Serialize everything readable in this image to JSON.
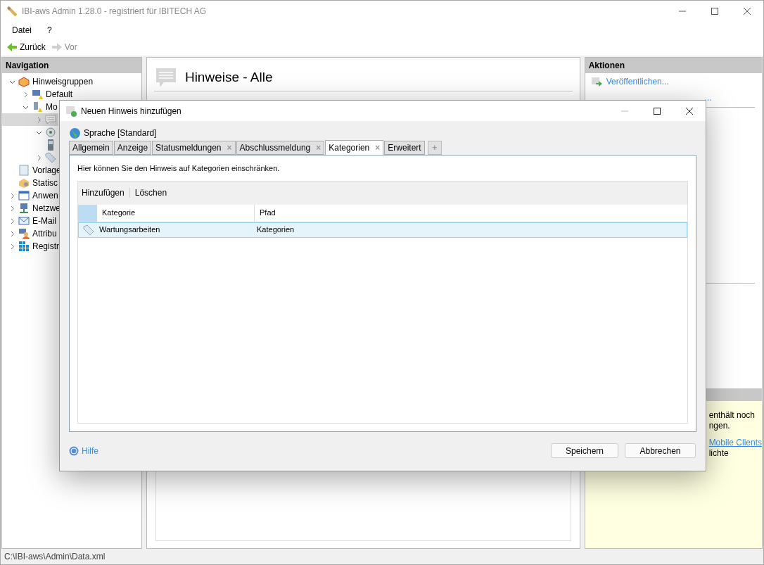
{
  "window": {
    "title": "IBI-aws Admin 1.28.0 - registriert für IBITECH AG"
  },
  "menu": [
    "Datei",
    "?"
  ],
  "nav_buttons": [
    {
      "label": "Zurück",
      "disabled": false
    },
    {
      "label": "Vor",
      "disabled": true
    }
  ],
  "navigation": {
    "title": "Navigation",
    "items": [
      {
        "label": "Hinweisgruppen",
        "kind": "box",
        "expanded": true,
        "selected": false,
        "children": [
          {
            "label": "Default",
            "kind": "monitor-warning",
            "expanded": false,
            "selected": false
          },
          {
            "label": "Mo",
            "kind": "device-warning",
            "expanded": true,
            "selected": false,
            "children": [
              {
                "kind": "message",
                "expanded": false,
                "selected": true
              },
              {
                "kind": "gear",
                "expanded": true,
                "selected": false
              },
              {
                "kind": "phone",
                "selected": false
              },
              {
                "kind": "tag",
                "expanded": false,
                "selected": false
              }
            ]
          }
        ]
      },
      {
        "label": "Vorlage",
        "kind": "template",
        "selected": false
      },
      {
        "label": "Statisc",
        "kind": "gear-box",
        "selected": false
      },
      {
        "label": "Anwen",
        "kind": "windows",
        "expanded": false,
        "selected": false
      },
      {
        "label": "Netzwe",
        "kind": "network",
        "expanded": false,
        "selected": false
      },
      {
        "label": "E-Mail",
        "kind": "mail",
        "expanded": false,
        "selected": false
      },
      {
        "label": "Attribu",
        "kind": "person",
        "expanded": false,
        "selected": false
      },
      {
        "label": "Registr",
        "kind": "grid",
        "expanded": false,
        "selected": false
      }
    ]
  },
  "content": {
    "title": "Hinweise - Alle"
  },
  "actions": {
    "title": "Aktionen",
    "links": [
      "Veröffentlichen...",
      "..."
    ]
  },
  "info_panel": {
    "lines": [
      {
        "kind": "text",
        "text": "enthält noch"
      },
      {
        "kind": "text",
        "text": "ngen."
      },
      {
        "kind": "link",
        "text": "Mobile Clients"
      },
      {
        "kind": "text",
        "text": "lichte"
      }
    ]
  },
  "status_bar": "C:\\IBI-aws\\Admin\\Data.xml",
  "dialog": {
    "title": "Neuen Hinweis hinzufügen",
    "language": "Sprache [Standard]",
    "tabs": [
      {
        "label": "Allgemein",
        "closable": false,
        "selected": false
      },
      {
        "label": "Anzeige",
        "closable": false,
        "selected": false
      },
      {
        "label": "Statusmeldungen",
        "closable": true,
        "selected": false
      },
      {
        "label": "Abschlussmeldung",
        "closable": true,
        "selected": false
      },
      {
        "label": "Kategorien",
        "closable": true,
        "selected": true
      },
      {
        "label": "Erweitert",
        "closable": false,
        "selected": false
      }
    ],
    "add_tab": "+",
    "close_glyph": "×",
    "description": "Hier können Sie den Hinweis auf Kategorien einschränken.",
    "toolbar": [
      "Hinzufügen",
      "Löschen"
    ],
    "table": {
      "columns": [
        "Kategorie",
        "Pfad"
      ],
      "rows": [
        {
          "cells": [
            "Wartungsarbeiten",
            "Kategorien"
          ],
          "selected": true
        }
      ]
    },
    "help": "Hilfe",
    "buttons": [
      "Speichern",
      "Abbrechen"
    ]
  }
}
